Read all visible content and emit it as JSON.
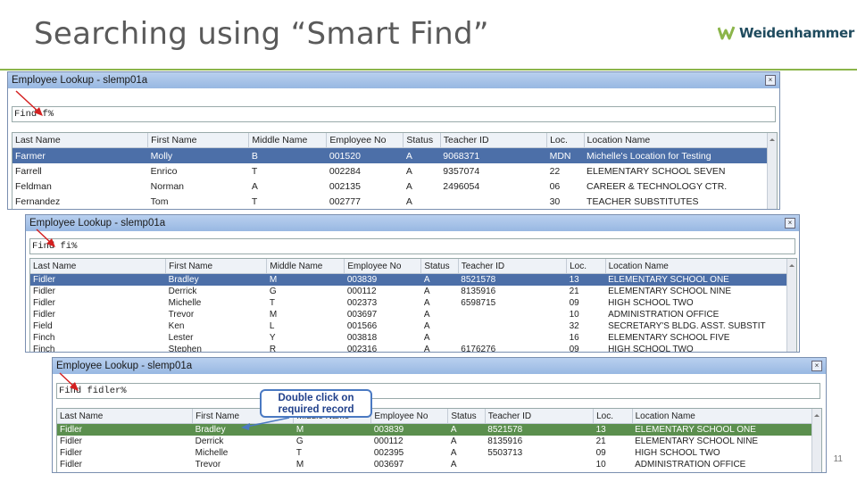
{
  "slide": {
    "title": "Searching using “Smart Find”",
    "logo_text": "Weidenhammer",
    "page_number": "11",
    "colors": {
      "rule": "#8bb54a",
      "selection": "#4c6fa8",
      "callout_border": "#4a79c2"
    }
  },
  "windows": [
    {
      "title": "Employee Lookup - slemp01a",
      "find_value": "Find f%",
      "columns": [
        "Last Name",
        "First Name",
        "Middle Name",
        "Employee No",
        "Status",
        "Teacher ID",
        "Loc.",
        "Location Name"
      ],
      "rows": [
        [
          "Farmer",
          "Molly",
          "B",
          "001520",
          "A",
          "9068371",
          "MDN",
          "Michelle's Location for Testing"
        ],
        [
          "Farrell",
          "Enrico",
          "T",
          "002284",
          "A",
          "9357074",
          "22",
          "ELEMENTARY SCHOOL SEVEN"
        ],
        [
          "Feldman",
          "Norman",
          "A",
          "002135",
          "A",
          "2496054",
          "06",
          "CAREER & TECHNOLOGY CTR."
        ],
        [
          "Fernandez",
          "Tom",
          "T",
          "002777",
          "A",
          "",
          "30",
          "TEACHER SUBSTITUTES"
        ]
      ],
      "selected_row": 0
    },
    {
      "title": "Employee Lookup - slemp01a",
      "find_value": "Find fi%",
      "columns": [
        "Last Name",
        "First Name",
        "Middle Name",
        "Employee No",
        "Status",
        "Teacher ID",
        "Loc.",
        "Location Name"
      ],
      "rows": [
        [
          "Fidler",
          "Bradley",
          "M",
          "003839",
          "A",
          "8521578",
          "13",
          "ELEMENTARY SCHOOL ONE"
        ],
        [
          "Fidler",
          "Derrick",
          "G",
          "000112",
          "A",
          "8135916",
          "21",
          "ELEMENTARY SCHOOL NINE"
        ],
        [
          "Fidler",
          "Michelle",
          "T",
          "002373",
          "A",
          "6598715",
          "09",
          "HIGH SCHOOL TWO"
        ],
        [
          "Fidler",
          "Trevor",
          "M",
          "003697",
          "A",
          "",
          "10",
          "ADMINISTRATION OFFICE"
        ],
        [
          "Field",
          "Ken",
          "L",
          "001566",
          "A",
          "",
          "32",
          "SECRETARY'S BLDG. ASST. SUBSTIT"
        ],
        [
          "Finch",
          "Lester",
          "Y",
          "003818",
          "A",
          "",
          "16",
          "ELEMENTARY SCHOOL FIVE"
        ],
        [
          "Finch",
          "Stephen",
          "R",
          "002316",
          "A",
          "6176276",
          "09",
          "HIGH SCHOOL TWO"
        ]
      ],
      "selected_row": 0
    },
    {
      "title": "Employee Lookup - slemp01a",
      "find_value": "Find fidler%",
      "columns": [
        "Last Name",
        "First Name",
        "Middle Name",
        "Employee No",
        "Status",
        "Teacher ID",
        "Loc.",
        "Location Name"
      ],
      "rows": [
        [
          "Fidler",
          "Bradley",
          "M",
          "003839",
          "A",
          "8521578",
          "13",
          "ELEMENTARY SCHOOL ONE"
        ],
        [
          "Fidler",
          "Derrick",
          "G",
          "000112",
          "A",
          "8135916",
          "21",
          "ELEMENTARY SCHOOL NINE"
        ],
        [
          "Fidler",
          "Michelle",
          "T",
          "002395",
          "A",
          "5503713",
          "09",
          "HIGH SCHOOL TWO"
        ],
        [
          "Fidler",
          "Trevor",
          "M",
          "003697",
          "A",
          "",
          "10",
          "ADMINISTRATION OFFICE"
        ]
      ],
      "selected_row": 0
    }
  ],
  "callout": {
    "text_line1": "Double click on",
    "text_line2": "required record"
  }
}
